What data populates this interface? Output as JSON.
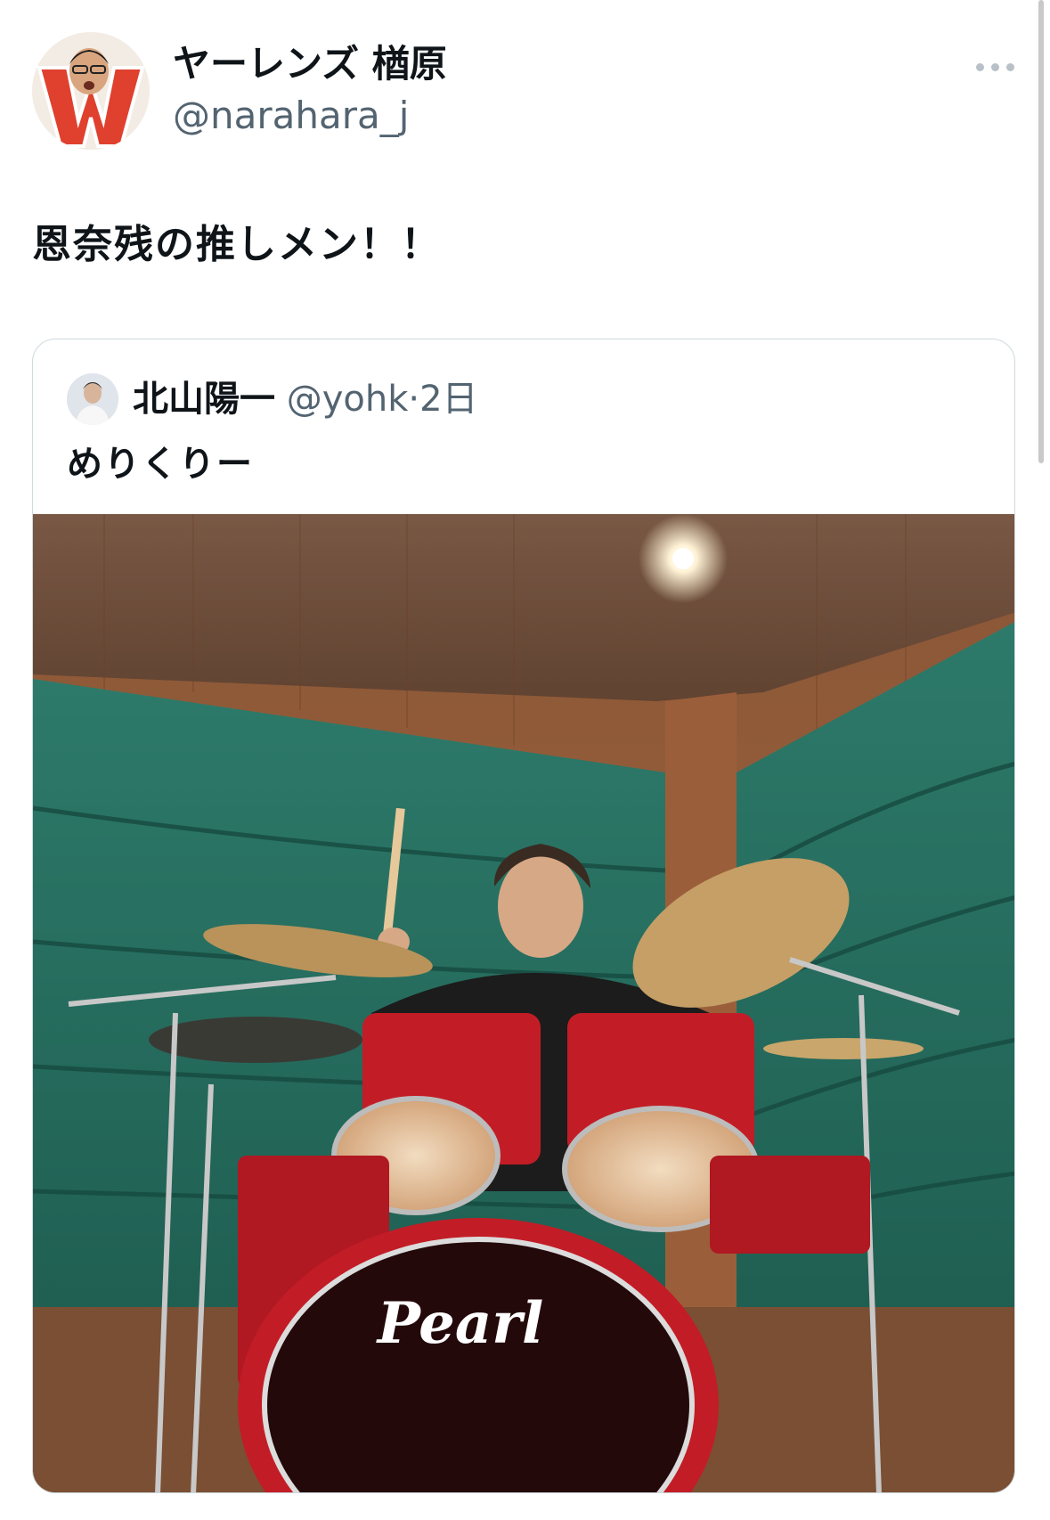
{
  "author": {
    "display_name": "ヤーレンズ 楢原",
    "handle": "@narahara_j",
    "avatar_icon": "profile-photo"
  },
  "more_icon": "more-options-icon",
  "tweet": {
    "text": "恩奈残の推しメン！！"
  },
  "quoted": {
    "display_name": "北山陽一",
    "handle": "@yohk",
    "separator": "·",
    "time": "2日",
    "text": "めりくりー",
    "photo_logo": "Pearl"
  }
}
